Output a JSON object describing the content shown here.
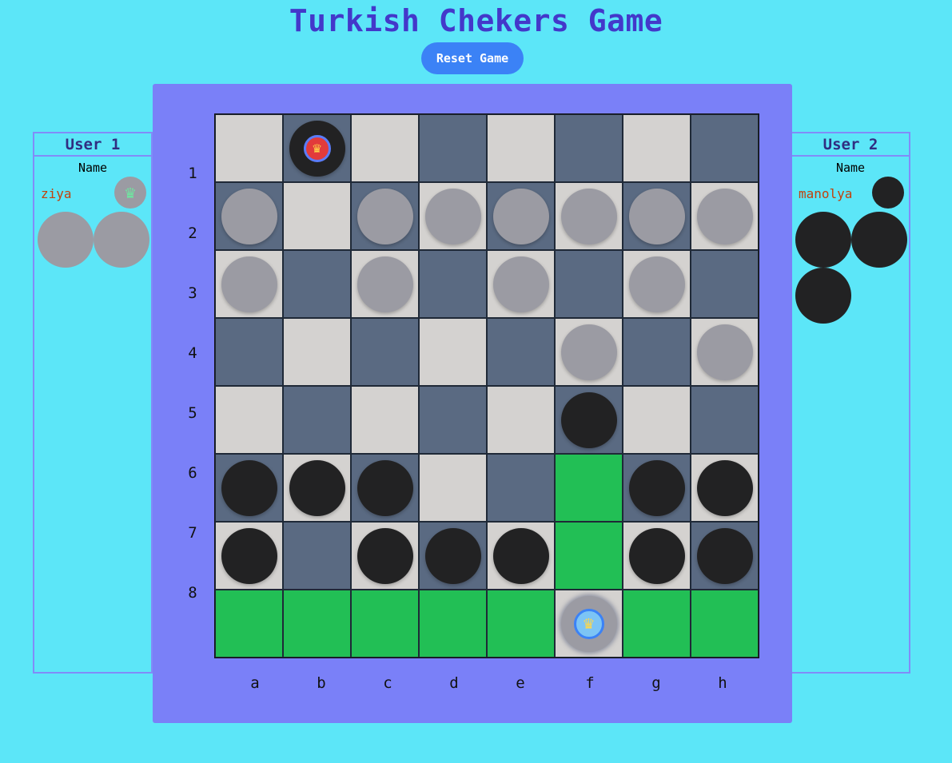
{
  "title": "Turkish Chekers Game",
  "reset_label": "Reset Game",
  "colors": {
    "background": "#5ce6f8",
    "frame": "#7a80f8",
    "light": "#d4d2d0",
    "dark": "#5a6a82",
    "highlight": "#22bf55",
    "white_piece": "#9b9ba3",
    "black_piece": "#222223"
  },
  "user1": {
    "heading": "User 1",
    "name_label": "Name",
    "name": "ziya",
    "indicator": "crown-icon",
    "captured_count": 2
  },
  "user2": {
    "heading": "User 2",
    "name_label": "Name",
    "name": "manolya",
    "captured_count": 3
  },
  "ranks": [
    "1",
    "2",
    "3",
    "4",
    "5",
    "6",
    "7",
    "8"
  ],
  "files": [
    "a",
    "b",
    "c",
    "d",
    "e",
    "f",
    "g",
    "h"
  ],
  "board": [
    [
      "L",
      "D",
      "L",
      "D",
      "L",
      "D",
      "L",
      "D"
    ],
    [
      "D",
      "L",
      "D",
      "L",
      "D",
      "L",
      "D",
      "L"
    ],
    [
      "L",
      "D",
      "L",
      "D",
      "L",
      "D",
      "L",
      "D"
    ],
    [
      "D",
      "L",
      "D",
      "L",
      "D",
      "L",
      "D",
      "L"
    ],
    [
      "L",
      "D",
      "L",
      "D",
      "L",
      "D",
      "L",
      "D"
    ],
    [
      "D",
      "L",
      "D",
      "L",
      "D",
      "H",
      "D",
      "L"
    ],
    [
      "L",
      "D",
      "L",
      "D",
      "L",
      "H",
      "L",
      "D"
    ],
    [
      "H",
      "H",
      "H",
      "H",
      "H",
      "L",
      "H",
      "H"
    ]
  ],
  "pieces": [
    [
      "",
      "BK",
      "",
      "",
      "",
      "",
      "",
      ""
    ],
    [
      "W",
      "",
      "W",
      "W",
      "W",
      "W",
      "W",
      "W"
    ],
    [
      "W",
      "",
      "W",
      "",
      "W",
      "",
      "W",
      ""
    ],
    [
      "",
      "",
      "",
      "",
      "",
      "W",
      "",
      "W"
    ],
    [
      "",
      "",
      "",
      "",
      "",
      "B",
      "",
      ""
    ],
    [
      "B",
      "B",
      "B",
      "",
      "",
      "",
      "B",
      "B"
    ],
    [
      "B",
      "",
      "B",
      "B",
      "B",
      "",
      "B",
      "B"
    ],
    [
      "",
      "",
      "",
      "",
      "",
      "WK",
      "",
      ""
    ]
  ]
}
